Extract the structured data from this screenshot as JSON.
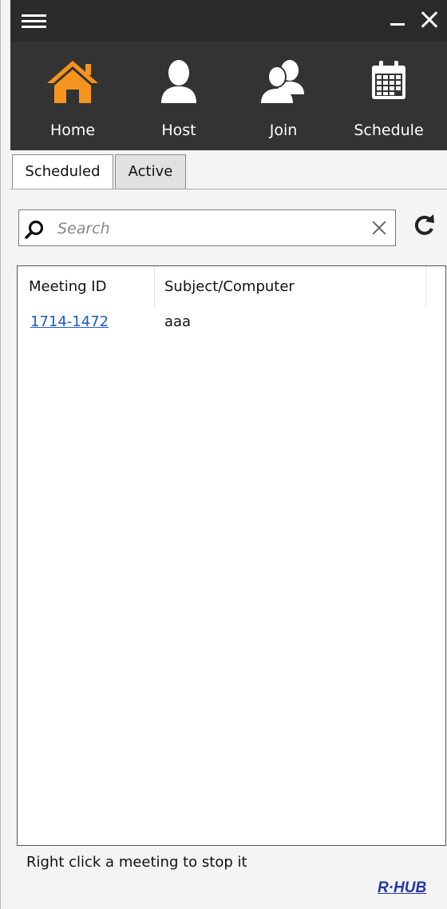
{
  "app": {
    "logo_text": "R·HUB",
    "colors": {
      "titlebar": "#2b2b2b",
      "toolbar": "#333333",
      "home_accent": "#f7941d",
      "link": "#1a5dc2",
      "logo": "#2535a8"
    }
  },
  "titlebar": {
    "menu_icon": "hamburger-icon",
    "minimize_icon": "minimize-icon",
    "close_icon": "close-icon"
  },
  "toolbar": {
    "items": [
      {
        "label": "Home",
        "icon": "home-icon",
        "active": true
      },
      {
        "label": "Host",
        "icon": "person-icon"
      },
      {
        "label": "Join",
        "icon": "people-icon"
      },
      {
        "label": "Schedule",
        "icon": "calendar-icon"
      }
    ]
  },
  "tabs": [
    {
      "label": "Scheduled"
    },
    {
      "label": "Active",
      "selected": true
    }
  ],
  "search": {
    "placeholder": "Search",
    "value": ""
  },
  "table": {
    "columns": [
      "Meeting ID",
      "Subject/Computer"
    ],
    "rows": [
      {
        "meeting_id": "1714-1472",
        "subject": "aaa"
      }
    ]
  },
  "footer": {
    "hint": "Right click a meeting to stop it"
  }
}
